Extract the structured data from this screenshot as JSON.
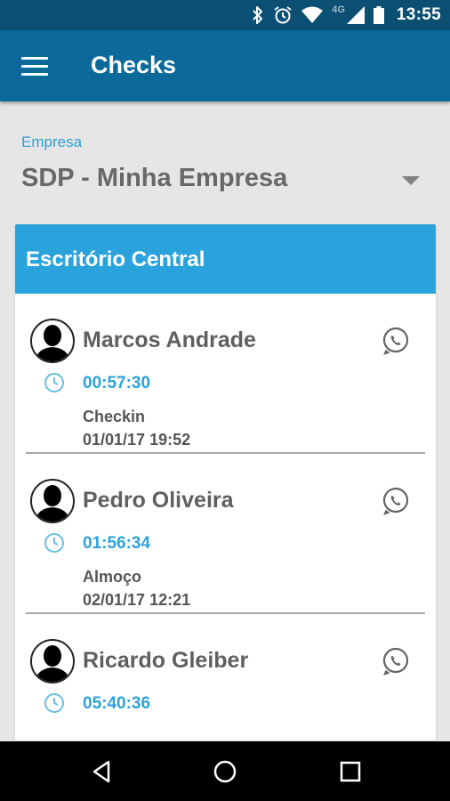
{
  "status_bar": {
    "network": "4G",
    "time": "13:55",
    "icons": [
      "bluetooth-icon",
      "alarm-icon",
      "wifi-icon",
      "signal-icon",
      "battery-icon"
    ]
  },
  "app_bar": {
    "title": "Checks",
    "menu_icon": "hamburger-icon"
  },
  "company": {
    "label": "Empresa",
    "selected": "SDP - Minha Empresa"
  },
  "card": {
    "title": "Escritório Central",
    "people": [
      {
        "name": "Marcos Andrade",
        "elapsed": "00:57:30",
        "event": "Checkin",
        "event_time": "01/01/17 19:52"
      },
      {
        "name": "Pedro Oliveira",
        "elapsed": "01:56:34",
        "event": "Almoço",
        "event_time": "02/01/17 12:21"
      },
      {
        "name": "Ricardo Gleiber",
        "elapsed": "05:40:36",
        "event": "",
        "event_time": ""
      }
    ]
  },
  "nav_bar": {
    "icons": [
      "back-icon",
      "home-icon",
      "recents-icon"
    ]
  },
  "colors": {
    "status_bar": "#0b4f73",
    "app_bar": "#0c6a9a",
    "accent": "#2aa3dc",
    "background": "#e6e6e6"
  }
}
